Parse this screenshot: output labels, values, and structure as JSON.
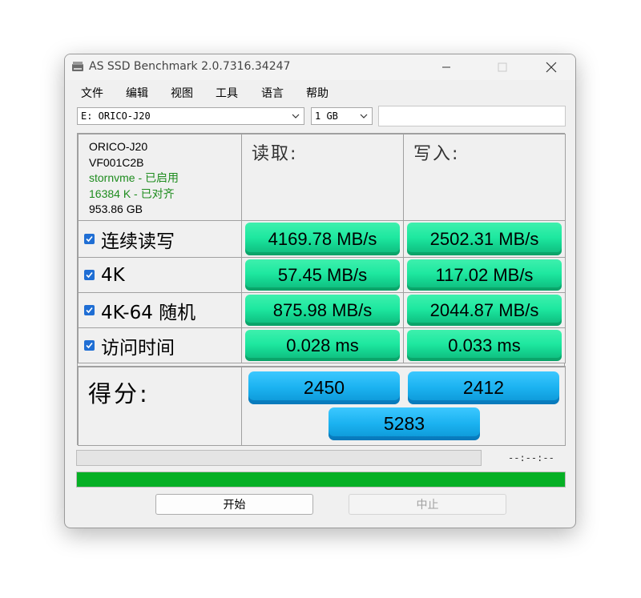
{
  "window": {
    "title": "AS SSD Benchmark 2.0.7316.34247"
  },
  "menu": [
    "文件",
    "编辑",
    "视图",
    "工具",
    "语言",
    "帮助"
  ],
  "drive_select": {
    "value": "E: ORICO-J20"
  },
  "size_select": {
    "value": "1 GB"
  },
  "info": {
    "name": "ORICO-J20",
    "firmware": "VF001C2B",
    "driver": "stornvme - 已启用",
    "alignment": "16384 K - 已对齐",
    "capacity": "953.86 GB"
  },
  "headers": {
    "read": "读取:",
    "write": "写入:"
  },
  "tests": [
    {
      "label": "连续读写",
      "read": "4169.78 MB/s",
      "write": "2502.31 MB/s",
      "checked": true
    },
    {
      "label": "4K",
      "read": "57.45 MB/s",
      "write": "117.02 MB/s",
      "checked": true
    },
    {
      "label": "4K-64 随机",
      "read": "875.98 MB/s",
      "write": "2044.87 MB/s",
      "checked": true
    },
    {
      "label": "访问时间",
      "read": "0.028 ms",
      "write": "0.033 ms",
      "checked": true
    }
  ],
  "score": {
    "label": "得分:",
    "read": "2450",
    "write": "2412",
    "total": "5283"
  },
  "status": {
    "timer": "--:--:--",
    "overall_progress_percent": 100,
    "progress_color": "#06b025",
    "current_progress_percent": 0
  },
  "buttons": {
    "start": "开始",
    "stop": "中止"
  },
  "colors": {
    "result_green": "#1ee8a0",
    "score_blue": "#1bb2f0",
    "checkbox_blue": "#1f6ed4"
  }
}
